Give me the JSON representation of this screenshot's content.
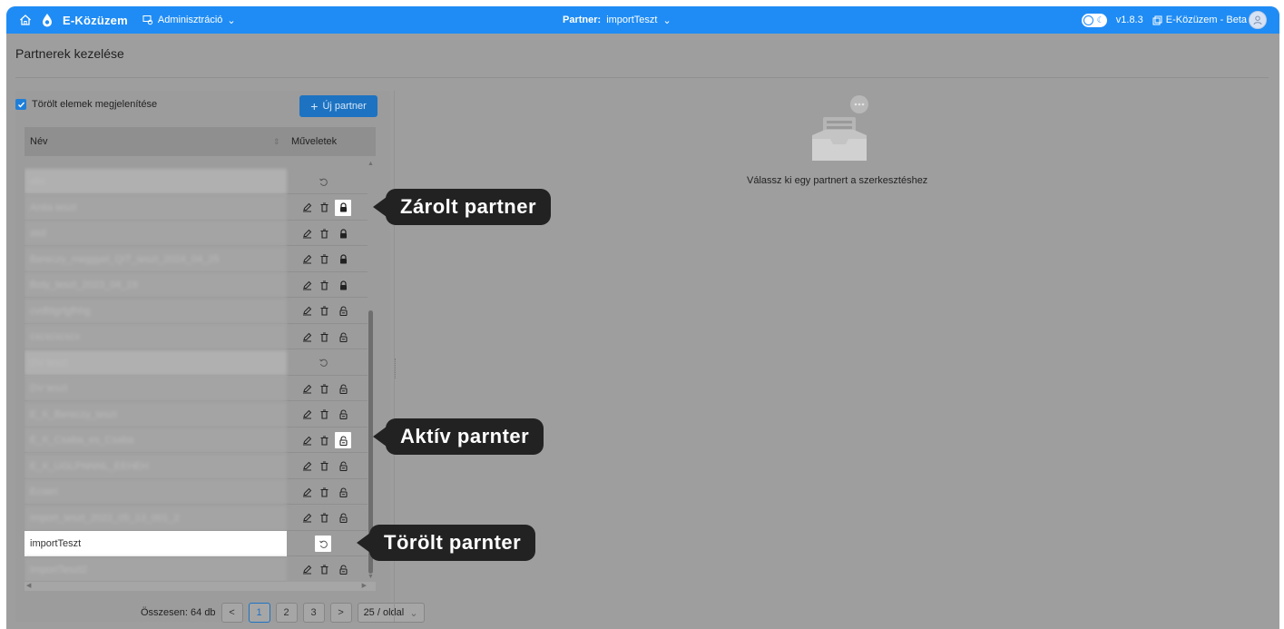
{
  "topbar": {
    "brand": "E-Közüzem",
    "admin_menu": "Adminisztráció",
    "partner_label": "Partner:",
    "partner_value": "importTeszt",
    "version": "v1.8.3",
    "env_label": "E-Közüzem - Beta"
  },
  "page": {
    "title": "Partnerek kezelése"
  },
  "left": {
    "show_deleted_label": "Törölt elemek megjelenítése",
    "show_deleted_checked": true,
    "new_partner_label": "Új partner",
    "columns": {
      "name": "Név",
      "ops": "Műveletek"
    },
    "rows": [
      {
        "name": "abc",
        "status": "deleted"
      },
      {
        "name": "Anita teszt",
        "status": "locked",
        "highlight_lock": true
      },
      {
        "name": "asd",
        "status": "locked"
      },
      {
        "name": "Bereczy_meggyel_QIT_teszt_2024_04_25",
        "status": "locked"
      },
      {
        "name": "Boty_teszt_2023_04_19",
        "status": "locked"
      },
      {
        "name": "cvdfdgrfgfhhg",
        "status": "active"
      },
      {
        "name": "cxcxcxcxcx",
        "status": "active"
      },
      {
        "name": "DV teszt",
        "status": "deleted"
      },
      {
        "name": "DV teszt",
        "status": "active"
      },
      {
        "name": "E_K_Bereczy_teszt",
        "status": "active"
      },
      {
        "name": "E_K_Csaba_es_Csaba",
        "status": "active",
        "highlight_lock": true
      },
      {
        "name": "E_K_UGLPNNNL_EEHEH",
        "status": "active"
      },
      {
        "name": "Ecseri",
        "status": "active"
      },
      {
        "name": "Import_teszt_2022_05_13_001_2",
        "status": "active"
      },
      {
        "name": "importTeszt",
        "status": "deleted",
        "highlight_row": true
      },
      {
        "name": "ImportTeszt2",
        "status": "active"
      }
    ],
    "pager": {
      "total": "Összesen: 64 db",
      "pages": [
        "1",
        "2",
        "3"
      ],
      "current": "1",
      "page_size": "25 / oldal"
    }
  },
  "right": {
    "empty_text": "Válassz ki egy partnert a szerkesztéshez"
  },
  "callouts": {
    "locked": "Zárolt partner",
    "active": "Aktív parnter",
    "deleted": "Törölt parnter"
  }
}
